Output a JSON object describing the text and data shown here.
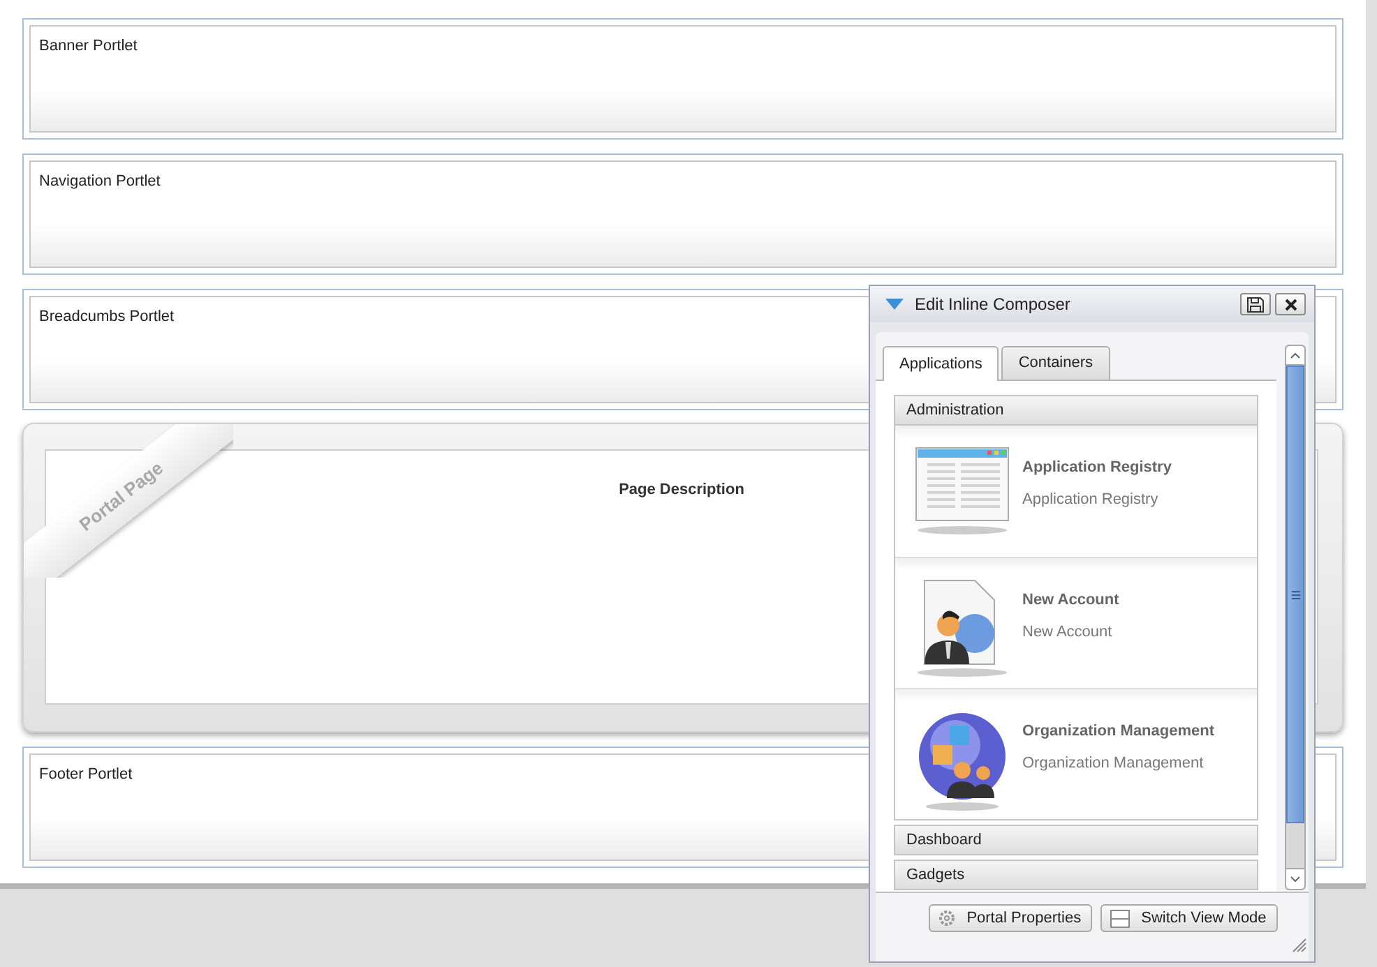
{
  "regions": [
    {
      "kind": "portlet",
      "title": "Banner Portlet"
    },
    {
      "kind": "portlet",
      "title": "Navigation Portlet"
    },
    {
      "kind": "portlet",
      "title": "Breadcumbs Portlet"
    },
    {
      "kind": "page",
      "ribbon": "Portal Page",
      "description": "Page Description"
    },
    {
      "kind": "portlet",
      "title": "Footer Portlet"
    }
  ],
  "composer": {
    "title": "Edit Inline Composer",
    "tabs": [
      {
        "label": "Applications",
        "selected": true
      },
      {
        "label": "Containers",
        "selected": false
      }
    ],
    "categories": [
      {
        "name": "Administration",
        "expanded": true,
        "applications": [
          {
            "title": "Application Registry",
            "description": "Application Registry"
          },
          {
            "title": "New Account",
            "description": "New Account"
          },
          {
            "title": "Organization Management",
            "description": "Organization Management"
          }
        ]
      },
      {
        "name": "Dashboard",
        "expanded": false
      },
      {
        "name": "Gadgets",
        "expanded": false
      }
    ],
    "buttons": [
      {
        "label": "Portal Properties"
      },
      {
        "label": "Switch View Mode"
      }
    ]
  }
}
